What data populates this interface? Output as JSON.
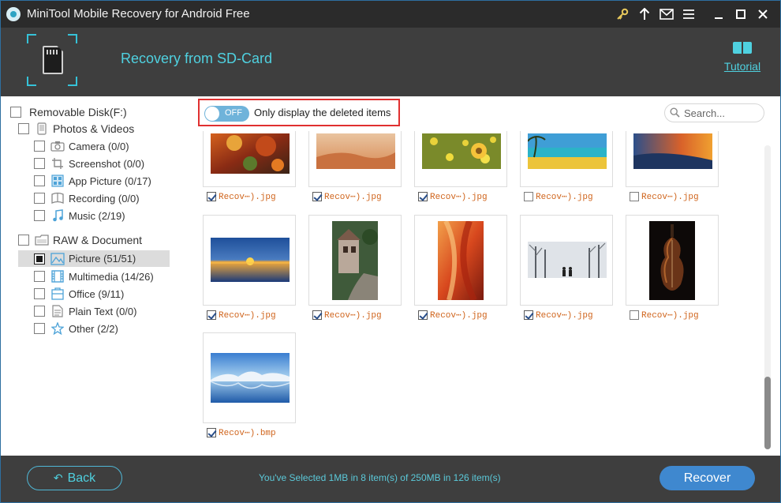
{
  "window": {
    "title": "MiniTool Mobile Recovery for Android Free",
    "controls": [
      "key-icon",
      "upgrade-arrow-icon",
      "mail-icon",
      "menu-icon",
      "minimize-icon",
      "maximize-icon",
      "close-icon"
    ]
  },
  "header": {
    "title": "Recovery from SD-Card",
    "tutorial_label": "Tutorial"
  },
  "sidebar": {
    "root": "Removable Disk(F:)",
    "groups": [
      {
        "label": "Photos & Videos",
        "items": [
          {
            "label": "Camera (0/0)",
            "icon": "camera-icon",
            "checked": false
          },
          {
            "label": "Screenshot (0/0)",
            "icon": "screenshot-icon",
            "checked": false
          },
          {
            "label": "App Picture (0/17)",
            "icon": "app-picture-icon",
            "checked": false
          },
          {
            "label": "Recording (0/0)",
            "icon": "recording-icon",
            "checked": false
          },
          {
            "label": "Music (2/19)",
            "icon": "music-icon",
            "checked": false
          }
        ]
      },
      {
        "label": "RAW & Document",
        "items": [
          {
            "label": "Picture (51/51)",
            "icon": "picture-icon",
            "checked": true,
            "selected": true
          },
          {
            "label": "Multimedia (14/26)",
            "icon": "multimedia-icon",
            "checked": false
          },
          {
            "label": "Office (9/11)",
            "icon": "office-icon",
            "checked": false
          },
          {
            "label": "Plain Text (0/0)",
            "icon": "plain-text-icon",
            "checked": false
          },
          {
            "label": "Other (2/2)",
            "icon": "star-icon",
            "checked": false
          }
        ]
      }
    ]
  },
  "filter": {
    "toggle_state": "OFF",
    "label": "Only display the deleted items"
  },
  "search": {
    "placeholder": "Search..."
  },
  "files": [
    {
      "name": "Recov⋯).jpg",
      "checked": true,
      "image": "autumn-leaves"
    },
    {
      "name": "Recov⋯).jpg",
      "checked": true,
      "image": "sand-dunes"
    },
    {
      "name": "Recov⋯).jpg",
      "checked": true,
      "image": "yellow-flowers"
    },
    {
      "name": "Recov⋯).jpg",
      "checked": false,
      "image": "tropical-beach"
    },
    {
      "name": "Recov⋯).jpg",
      "checked": false,
      "image": "sunset-shore"
    },
    {
      "name": "Recov⋯).jpg",
      "checked": true,
      "image": "ocean-sunset"
    },
    {
      "name": "Recov⋯).jpg",
      "checked": true,
      "image": "old-house-alley"
    },
    {
      "name": "Recov⋯).jpg",
      "checked": true,
      "image": "red-canyon"
    },
    {
      "name": "Recov⋯).jpg",
      "checked": true,
      "image": "snowy-park"
    },
    {
      "name": "Recov⋯).jpg",
      "checked": false,
      "image": "violin"
    },
    {
      "name": "Recov⋯).bmp",
      "checked": true,
      "image": "winter-lake"
    }
  ],
  "scroll_position": 0.78,
  "footer": {
    "back_label": "Back",
    "status": "You've Selected 1MB in 8 item(s) of 250MB in 126 item(s)",
    "recover_label": "Recover"
  },
  "colors": {
    "accent": "#4fd1e0",
    "header_bg": "#3e3e3e",
    "titlebar_bg": "#2b2b2b",
    "recover_button": "#3f88cf",
    "filename_text": "#d0651d",
    "highlight_border": "#e03030"
  }
}
